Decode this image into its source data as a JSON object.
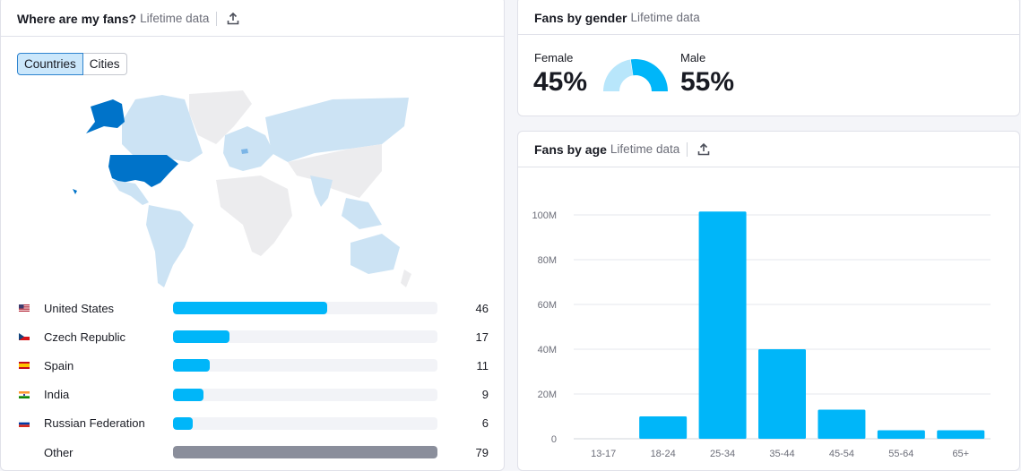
{
  "fans_map": {
    "title": "Where are my fans?",
    "subtitle": "Lifetime data",
    "export_icon": "export-upload-icon",
    "tabs": [
      {
        "label": "Countries",
        "active": true
      },
      {
        "label": "Cities",
        "active": false
      }
    ],
    "countries": [
      {
        "flag": "us-flag-icon",
        "name": "United States",
        "value": "46",
        "percent": 46
      },
      {
        "flag": "cz-flag-icon",
        "name": "Czech Republic",
        "value": "17",
        "percent": 17
      },
      {
        "flag": "es-flag-icon",
        "name": "Spain",
        "value": "11",
        "percent": 11
      },
      {
        "flag": "in-flag-icon",
        "name": "India",
        "value": "9",
        "percent": 9
      },
      {
        "flag": "ru-flag-icon",
        "name": "Russian Federation",
        "value": "6",
        "percent": 6
      },
      {
        "flag": "",
        "name": "Other",
        "value": "79",
        "percent": 79
      }
    ],
    "bar_max": 79,
    "colors": {
      "bar": "#00b6f9",
      "other": "#8a8e9b",
      "map_high": "#0073c9",
      "map_low": "#cce3f4",
      "map_none": "#ececee"
    }
  },
  "gender": {
    "title": "Fans by gender",
    "subtitle": "Lifetime data",
    "female_label": "Female",
    "female_value": "45%",
    "female_percent": 45,
    "male_label": "Male",
    "male_value": "55%",
    "male_percent": 55,
    "colors": {
      "female": "#b8e6fb",
      "male": "#00b6f9"
    }
  },
  "age": {
    "title": "Fans by age",
    "subtitle": "Lifetime data",
    "export_icon": "export-upload-icon"
  },
  "chart_data": {
    "type": "bar",
    "title": "Fans by age",
    "xlabel": "",
    "ylabel": "",
    "categories": [
      "13-17",
      "18-24",
      "25-34",
      "35-44",
      "45-54",
      "55-64",
      "65+"
    ],
    "values": [
      0,
      10000000,
      101500000,
      40000000,
      13000000,
      3800000,
      3800000
    ],
    "yticks": [
      0,
      20000000,
      40000000,
      60000000,
      80000000,
      100000000
    ],
    "ytick_labels": [
      "0",
      "20M",
      "40M",
      "60M",
      "80M",
      "100M"
    ],
    "ylim": [
      0,
      100000000
    ],
    "grid": true,
    "color": "#00b6f9"
  }
}
